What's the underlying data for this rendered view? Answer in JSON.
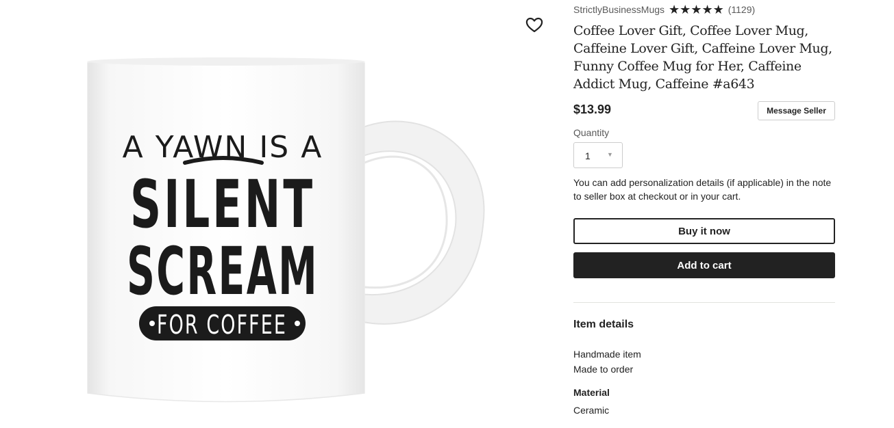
{
  "listing": {
    "shop_name": "StrictlyBusinessMugs",
    "rating_stars": "★★★★★",
    "review_count": "(1129)",
    "title": "Coffee Lover Gift, Coffee Lover Mug, Caffeine Lover Gift, Caffeine Lover Mug, Funny Coffee Mug for Her, Caffeine Addict Mug, Caffeine #a643",
    "price": "$13.99",
    "message_seller_label": "Message Seller"
  },
  "product_image": {
    "mug_text_line1": "A YAWN IS A",
    "mug_text_line2": "SILENT",
    "mug_text_line3": "SCREAM",
    "mug_text_line4": "FOR COFFEE",
    "favorite_icon": "heart-outline-icon"
  },
  "quantity": {
    "label": "Quantity",
    "selected": "1",
    "caret_icon": "caret-down-icon"
  },
  "personalization_note": "You can add personalization details (if applicable) in the note to seller box at checkout or in your cart.",
  "actions": {
    "buy_now_label": "Buy it now",
    "add_to_cart_label": "Add to cart"
  },
  "item_details": {
    "heading": "Item details",
    "highlights": [
      "Handmade item",
      "Made to order"
    ],
    "material_label": "Material",
    "material_value": "Ceramic"
  },
  "colors": {
    "primary_text": "#222222",
    "secondary_text": "#595959",
    "button_dark": "#222222",
    "border": "#cccccc"
  }
}
